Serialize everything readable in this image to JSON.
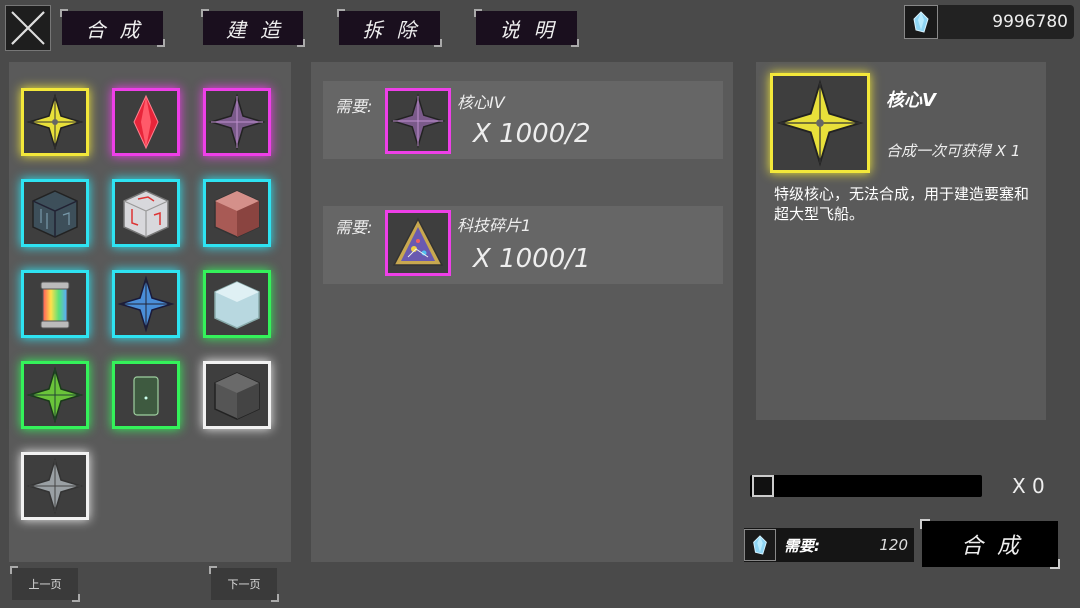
{
  "tabs": [
    {
      "label": "合成"
    },
    {
      "label": "建造"
    },
    {
      "label": "拆除"
    },
    {
      "label": "说明"
    }
  ],
  "currency": {
    "value": "9996780",
    "icon": "crystal-icon"
  },
  "inventory": [
    {
      "item": "core-v",
      "color": "#f3e83a"
    },
    {
      "item": "red-crystal",
      "color": "#ee3fe8"
    },
    {
      "item": "core-iv",
      "color": "#ee3fe8"
    },
    {
      "item": "dark-circuit-cube",
      "color": "#2ee3f2"
    },
    {
      "item": "white-circuit-cube",
      "color": "#2ee3f2"
    },
    {
      "item": "red-cube",
      "color": "#2ee3f2"
    },
    {
      "item": "rainbow-capsule",
      "color": "#2ee3f2"
    },
    {
      "item": "blue-core",
      "color": "#2ee3f2"
    },
    {
      "item": "glass-cube",
      "color": "#34f25a"
    },
    {
      "item": "green-core",
      "color": "#34f25a"
    },
    {
      "item": "green-canister",
      "color": "#34f25a"
    },
    {
      "item": "gray-cube",
      "color": "#f2f2f2"
    },
    {
      "item": "gray-core",
      "color": "#f2f2f2"
    }
  ],
  "requirements": [
    {
      "label": "需要:",
      "name": "核心IV",
      "count": "X 1000/2",
      "color": "#ee3fe8"
    },
    {
      "label": "需要:",
      "name": "科技碎片1",
      "count": "X 1000/1",
      "color": "#ee3fe8"
    }
  ],
  "detail": {
    "name": "核心V",
    "yield": "合成一次可获得 X 1",
    "description": "特级核心，无法合成，用于建造要塞和超大型飞船。",
    "color": "#f3e83a"
  },
  "slider": {
    "quantity": "X 0",
    "level": 0
  },
  "cost": {
    "label": "需要:",
    "value": "120"
  },
  "craft_button": "合成",
  "pagination": {
    "prev": "上一页",
    "next": "下一页"
  }
}
